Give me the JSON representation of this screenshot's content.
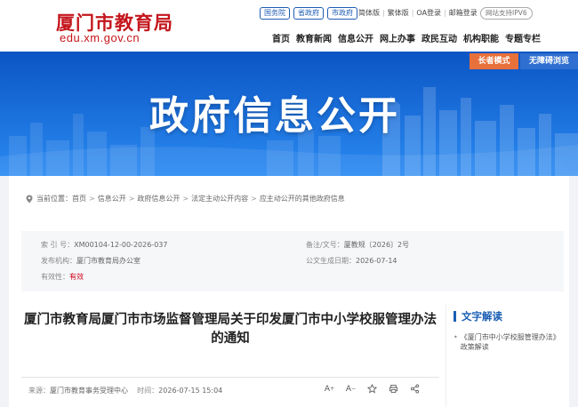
{
  "header": {
    "logo_cn": "厦门市教育局",
    "logo_en": "edu.xm.gov.cn",
    "gov_links": [
      "国务院",
      "省政府",
      "市政府"
    ],
    "top_links": [
      "简体版",
      "繁体版",
      "OA登录",
      "邮箱登录"
    ],
    "ipv6": "网站支持IPV6",
    "nav": [
      "首页",
      "教育新闻",
      "信息公开",
      "网上办事",
      "政民互动",
      "机构职能",
      "专题专栏"
    ]
  },
  "banner": {
    "title": "政府信息公开",
    "elder_mode": "长者模式",
    "accessible": "无障碍浏览"
  },
  "breadcrumb": {
    "label": "当前位置：",
    "items": [
      "首页",
      "信息公开",
      "政府信息公开",
      "法定主动公开内容",
      "应主动公开的其他政府信息"
    ]
  },
  "info": {
    "index_label": "索 引 号：",
    "index_value": "XM00104-12-00-2026-037",
    "doc_label": "备注/文号：",
    "doc_value": "厦教规〔2026〕2号",
    "org_label": "发布机构：",
    "org_value": "厦门市教育局办公室",
    "date_label": "公文生成日期：",
    "date_value": "2026-07-14",
    "valid_label": "有效性：",
    "valid_value": "有效"
  },
  "article": {
    "title": "厦门市教育局厦门市市场监督管理局关于印发厦门市中小学校服管理办法的通知",
    "source_label": "来源：",
    "source_value": "厦门市教育事务受理中心",
    "time_label": "时间：",
    "time_value": "2026-07-15 15:04"
  },
  "side": {
    "title": "文字解读",
    "items": [
      "《厦门市中小学校服管理办法》政策解读"
    ]
  },
  "colors": {
    "brand_red": "#c4161c",
    "banner_blue": "#1170e3",
    "accent_blue": "#1a5fb4",
    "elder_orange": "#e8703a"
  }
}
